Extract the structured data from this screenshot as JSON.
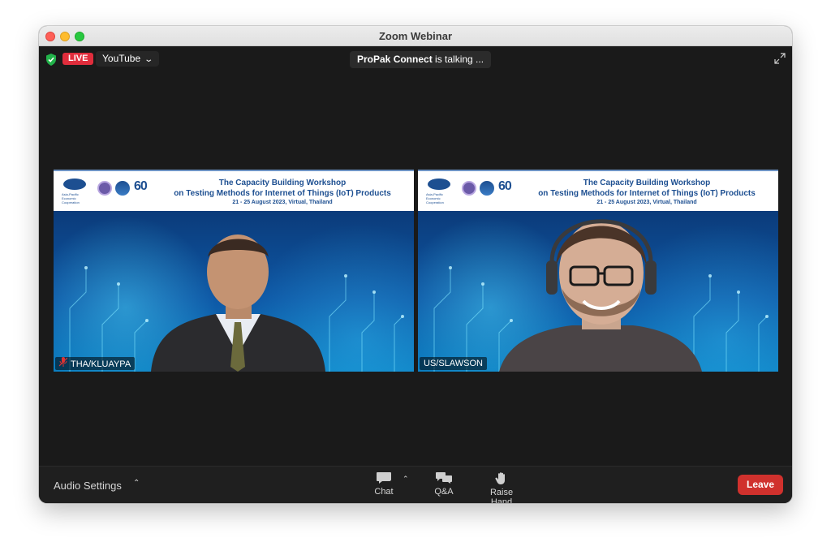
{
  "window": {
    "title": "Zoom Webinar"
  },
  "status": {
    "live_label": "LIVE",
    "stream_target": "YouTube",
    "talking_name": "ProPak Connect",
    "talking_suffix": " is talking ..."
  },
  "banner": {
    "line1": "The Capacity Building Workshop",
    "line2": "on Testing Methods for Internet of Things (IoT) Products",
    "line3": "21 - 25 August 2023, Virtual, Thailand",
    "apec_text": "Asia-Pacific Economic Cooperation",
    "sixty_text": "60"
  },
  "participants": [
    {
      "name": "THA/KLUAYPA",
      "muted": true
    },
    {
      "name": "US/SLAWSON",
      "muted": false
    }
  ],
  "toolbar": {
    "audio_settings": "Audio Settings",
    "chat": "Chat",
    "qa": "Q&A",
    "raise_hand": "Raise Hand",
    "leave": "Leave"
  },
  "colors": {
    "live_red": "#e02d3c",
    "leave_red": "#d0312d",
    "shield_green": "#22b34a",
    "banner_blue": "#1d4f91"
  }
}
